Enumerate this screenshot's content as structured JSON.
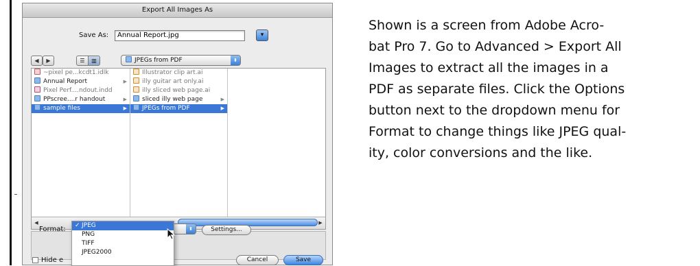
{
  "caption": {
    "lines": [
      "Shown is a screen from Adobe Acro-",
      "bat Pro 7. Go to Advanced > Export All",
      "Images to extract all the images in a",
      "PDF as separate files. Click the Options",
      "button next to the dropdown menu for",
      "Format to change things like JPEG qual-",
      "ity, color conversions and the like."
    ]
  },
  "dialog": {
    "title": "Export All Images As",
    "save_as_label": "Save As:",
    "save_as_value": "Annual Report.jpg",
    "location": "JPEGs from PDF",
    "nav": {
      "back_glyph": "◀",
      "forward_glyph": "▶"
    },
    "columns": [
      [
        {
          "name": "~pixel pe...kcdt1.idlk",
          "icon": "doc-icon",
          "muted": true,
          "arrow": false
        },
        {
          "name": "Annual Report",
          "icon": "folder-icon",
          "muted": false,
          "arrow": true
        },
        {
          "name": "Pixel Perf....ndout.indd",
          "icon": "indd-icon",
          "muted": true,
          "arrow": false
        },
        {
          "name": "PPscree....r handout",
          "icon": "folder-icon",
          "muted": false,
          "arrow": true
        },
        {
          "name": "sample files",
          "icon": "folder-icon",
          "muted": false,
          "arrow": true,
          "selected": true
        }
      ],
      [
        {
          "name": "Illustrator clip art.ai",
          "icon": "ai-icon",
          "muted": true,
          "arrow": false
        },
        {
          "name": "illy guitar art only.ai",
          "icon": "ai-icon",
          "muted": true,
          "arrow": false
        },
        {
          "name": "illy sliced web page.ai",
          "icon": "ai-icon",
          "muted": true,
          "arrow": false
        },
        {
          "name": "sliced illy web page",
          "icon": "folder-icon",
          "muted": false,
          "arrow": true
        },
        {
          "name": "JPEGs from PDF",
          "icon": "folder-icon",
          "muted": false,
          "arrow": true,
          "selected": true
        }
      ]
    ],
    "format_label": "Format:",
    "format_options": [
      "JPEG",
      "PNG",
      "TIFF",
      "JPEG2000"
    ],
    "format_selected": "JPEG",
    "settings_label": "Settings...",
    "hide_label": "Hide e",
    "cancel_label": "Cancel",
    "save_label": "Save"
  }
}
